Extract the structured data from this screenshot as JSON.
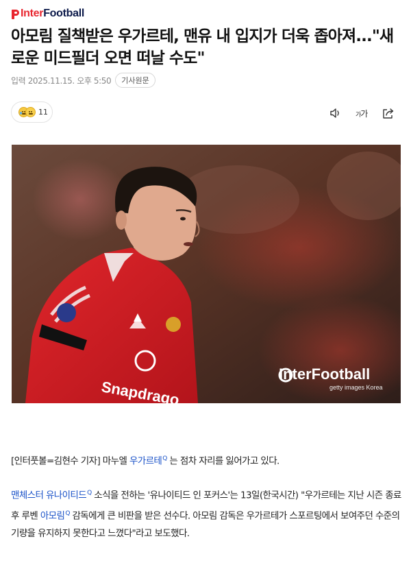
{
  "header": {
    "logo_text_part1": "Inter",
    "logo_text_part2": "Football"
  },
  "article": {
    "title": "아모림 질책받은 우가르테, 맨유 내 입지가 더욱 좁아져...\"새로운 미드필더 오면 떠날 수도\"",
    "date": "입력 2025.11.15. 오후 5:50",
    "original_label": "기사원문",
    "reaction_count": "11",
    "font_label_small": "가",
    "font_label_large": "가"
  },
  "photo": {
    "watermark": "InterFootball",
    "credit": "getty images Korea",
    "sponsor": "Snapdragon",
    "alt": "Manuel Ugarte in Manchester United red shirt"
  },
  "body": {
    "p1_prefix": "[인터풋볼=김현수 기자] 마누엘 ",
    "p1_link": "우가르테",
    "p1_suffix": " 는 점차 자리를 잃어가고 있다.",
    "p2_link1": "맨체스터 유나이티드",
    "p2_mid1": "  소식을 전하는 '유나이티드 인 포커스'는 13일(한국시간) \"우가르테는 지난 시즌 종료 후 루벤 ",
    "p2_link2": "아모림",
    "p2_suffix": "  감독에게 큰 비판을 받은 선수다. 아모림 감독은 우가르테가 스포르팅에서 보여주던 수준의 기량을 유지하지 못한다고 느꼈다\"라고 보도했다.",
    "search_mark": "Q"
  },
  "colors": {
    "brand_red": "#e8262f",
    "brand_navy": "#0c1a4a",
    "link": "#1a52c8"
  }
}
